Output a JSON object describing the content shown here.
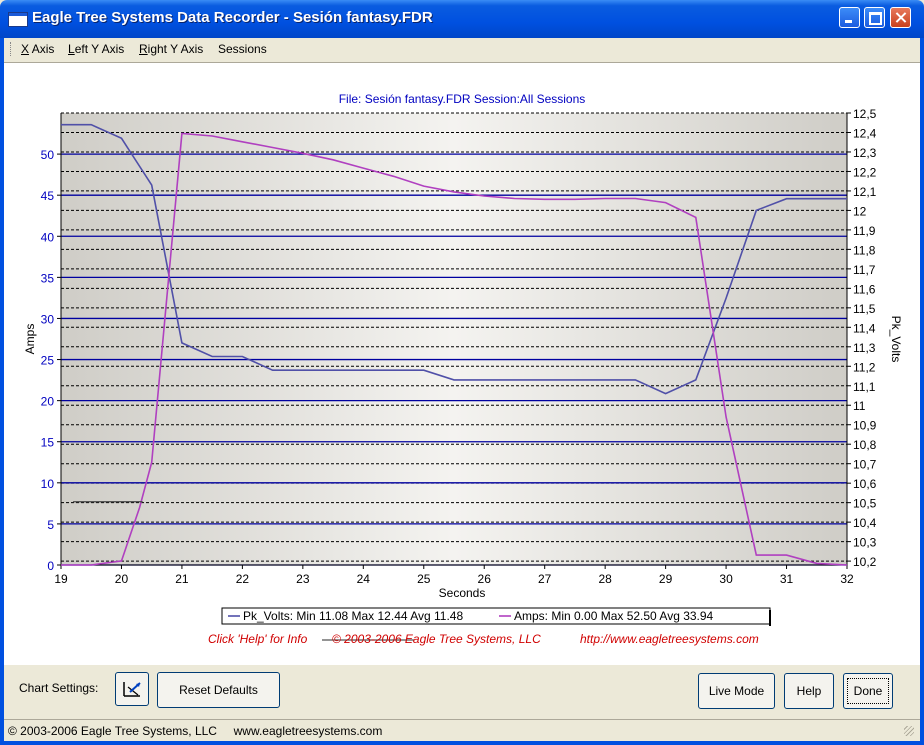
{
  "window": {
    "title": "Eagle Tree Systems Data Recorder - Sesión fantasy.FDR"
  },
  "menu": {
    "x_axis": {
      "key": "X",
      "rest": " Axis"
    },
    "left_y": {
      "key": "L",
      "rest": "eft Y Axis"
    },
    "right_y": {
      "key": "R",
      "rest": "ight Y Axis"
    },
    "sessions": "Sessions"
  },
  "chart_header": "File: Sesión fantasy.FDR   Session:All Sessions",
  "legend": {
    "volts": "Pk_Volts:  Min 11.08 Max 12.44 Avg 11.48",
    "amps": "Amps:   Min 0.00 Max 52.50 Avg 33.94"
  },
  "footer_info": {
    "help": "Click 'Help' for Info",
    "copyright": "© 2003-2006 Eagle Tree Systems, LLC",
    "url": "http://www.eagletreesystems.com"
  },
  "bottom": {
    "chart_settings_label": "Chart Settings:",
    "reset_label": "Reset Defaults",
    "live_label": "Live Mode",
    "help_label": "Help",
    "done_label": "Done"
  },
  "status": "© 2003-2006 Eagle Tree Systems, LLC     www.eagletreesystems.com",
  "colors": {
    "volts": "#5050a8",
    "amps": "#b040c0",
    "grid_solid": "#0000a0",
    "axis_text": "#0000c0",
    "footer": "#d00000"
  },
  "chart_data": {
    "type": "line",
    "xlabel": "Seconds",
    "ylabel_left": "Amps",
    "ylabel_right": "Pk_Volts",
    "xlim": [
      19,
      32
    ],
    "x_ticks": [
      "19",
      "20",
      "21",
      "22",
      "23",
      "24",
      "25",
      "26",
      "27",
      "28",
      "29",
      "30",
      "31",
      "32"
    ],
    "ylim_left": [
      0,
      55
    ],
    "left_ticks": [
      "0",
      "5",
      "10",
      "15",
      "20",
      "25",
      "30",
      "35",
      "40",
      "45",
      "50"
    ],
    "ylim_right": [
      10.18,
      12.5
    ],
    "right_ticks": [
      "10,2",
      "10,3",
      "10,4",
      "10,5",
      "10,6",
      "10,7",
      "10,8",
      "10,9",
      "11",
      "11,1",
      "11,2",
      "11,3",
      "11,4",
      "11,5",
      "11,6",
      "11,7",
      "11,8",
      "11,9",
      "12",
      "12,1",
      "12,2",
      "12,3",
      "12,4",
      "12,5"
    ],
    "series": [
      {
        "name": "Pk_Volts",
        "axis": "right",
        "x": [
          19.0,
          19.5,
          20.0,
          20.5,
          21.0,
          21.5,
          22.0,
          22.5,
          23.0,
          24.0,
          25.0,
          25.5,
          26.0,
          27.0,
          28.5,
          29.0,
          29.5,
          30.0,
          30.5,
          31.0,
          32.0
        ],
        "y": [
          12.44,
          12.44,
          12.37,
          12.13,
          11.32,
          11.25,
          11.25,
          11.18,
          11.18,
          11.18,
          11.18,
          11.13,
          11.13,
          11.13,
          11.13,
          11.06,
          11.13,
          11.55,
          12.0,
          12.06,
          12.06
        ]
      },
      {
        "name": "Amps",
        "axis": "left",
        "x": [
          19.0,
          19.5,
          20.0,
          20.3,
          20.5,
          21.0,
          21.5,
          22.0,
          22.5,
          23.0,
          23.5,
          24.0,
          24.5,
          25.0,
          25.5,
          26.0,
          26.5,
          27.0,
          27.5,
          28.0,
          28.5,
          29.0,
          29.5,
          30.0,
          30.5,
          31.0,
          31.5,
          32.0
        ],
        "y": [
          0,
          0,
          0.5,
          7,
          12.5,
          52.5,
          52.2,
          51.5,
          50.8,
          50.1,
          49.3,
          48.3,
          47.3,
          46.1,
          45.4,
          44.9,
          44.6,
          44.5,
          44.5,
          44.6,
          44.6,
          44.1,
          42.3,
          18,
          1.2,
          1.2,
          0.2,
          0
        ]
      }
    ]
  }
}
